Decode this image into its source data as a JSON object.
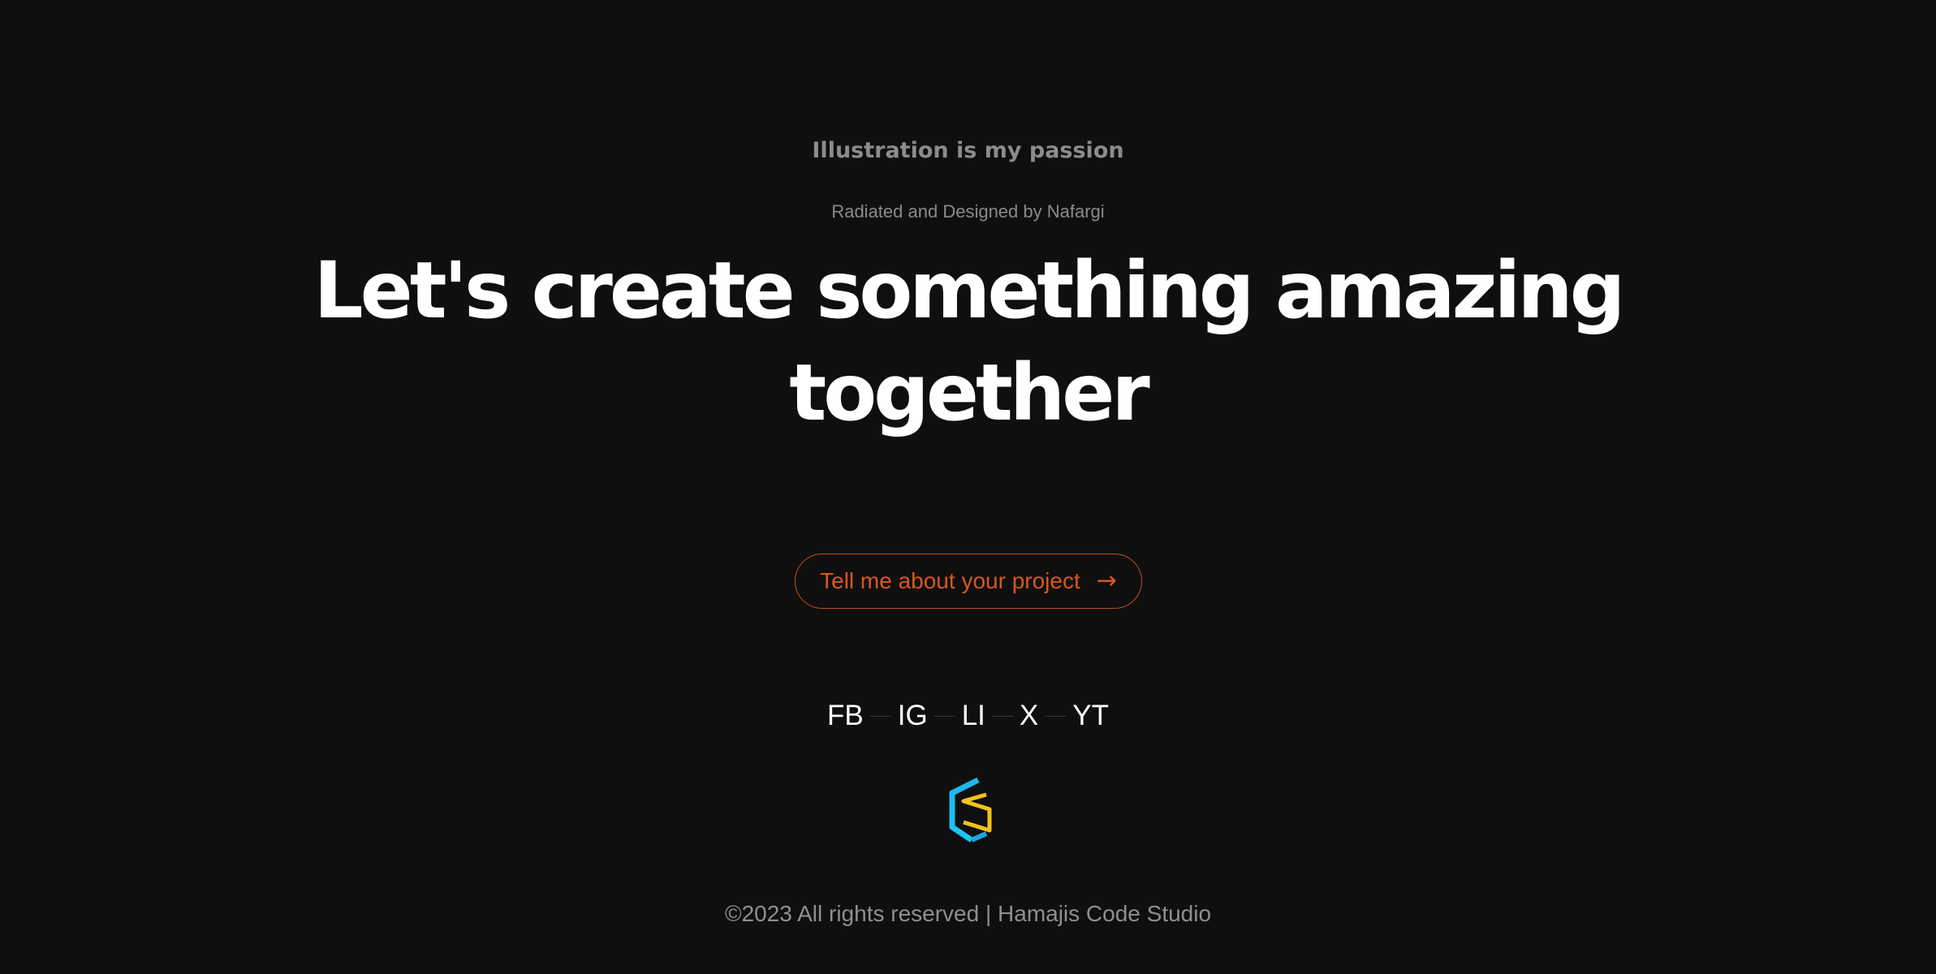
{
  "theme": {
    "background": "#0f0f0f",
    "accent": "#d8561f",
    "text_primary": "#ffffff",
    "text_muted": "#8c8c8c"
  },
  "hero": {
    "tagline": "Illustration is my passion",
    "credit": "Radiated and Designed by Nafargi",
    "headline_line1": "Let's create something amazing",
    "headline_line2": "together"
  },
  "cta": {
    "label": "Tell me about your project",
    "icon": "arrow-right-icon"
  },
  "social": {
    "links": [
      {
        "label": "FB"
      },
      {
        "label": "IG"
      },
      {
        "label": "LI"
      },
      {
        "label": "X"
      },
      {
        "label": "YT"
      }
    ]
  },
  "logo": {
    "icon": "hcs-logo-icon"
  },
  "footer": {
    "copyright": "©2023 All rights reserved | Hamajis Code Studio"
  }
}
